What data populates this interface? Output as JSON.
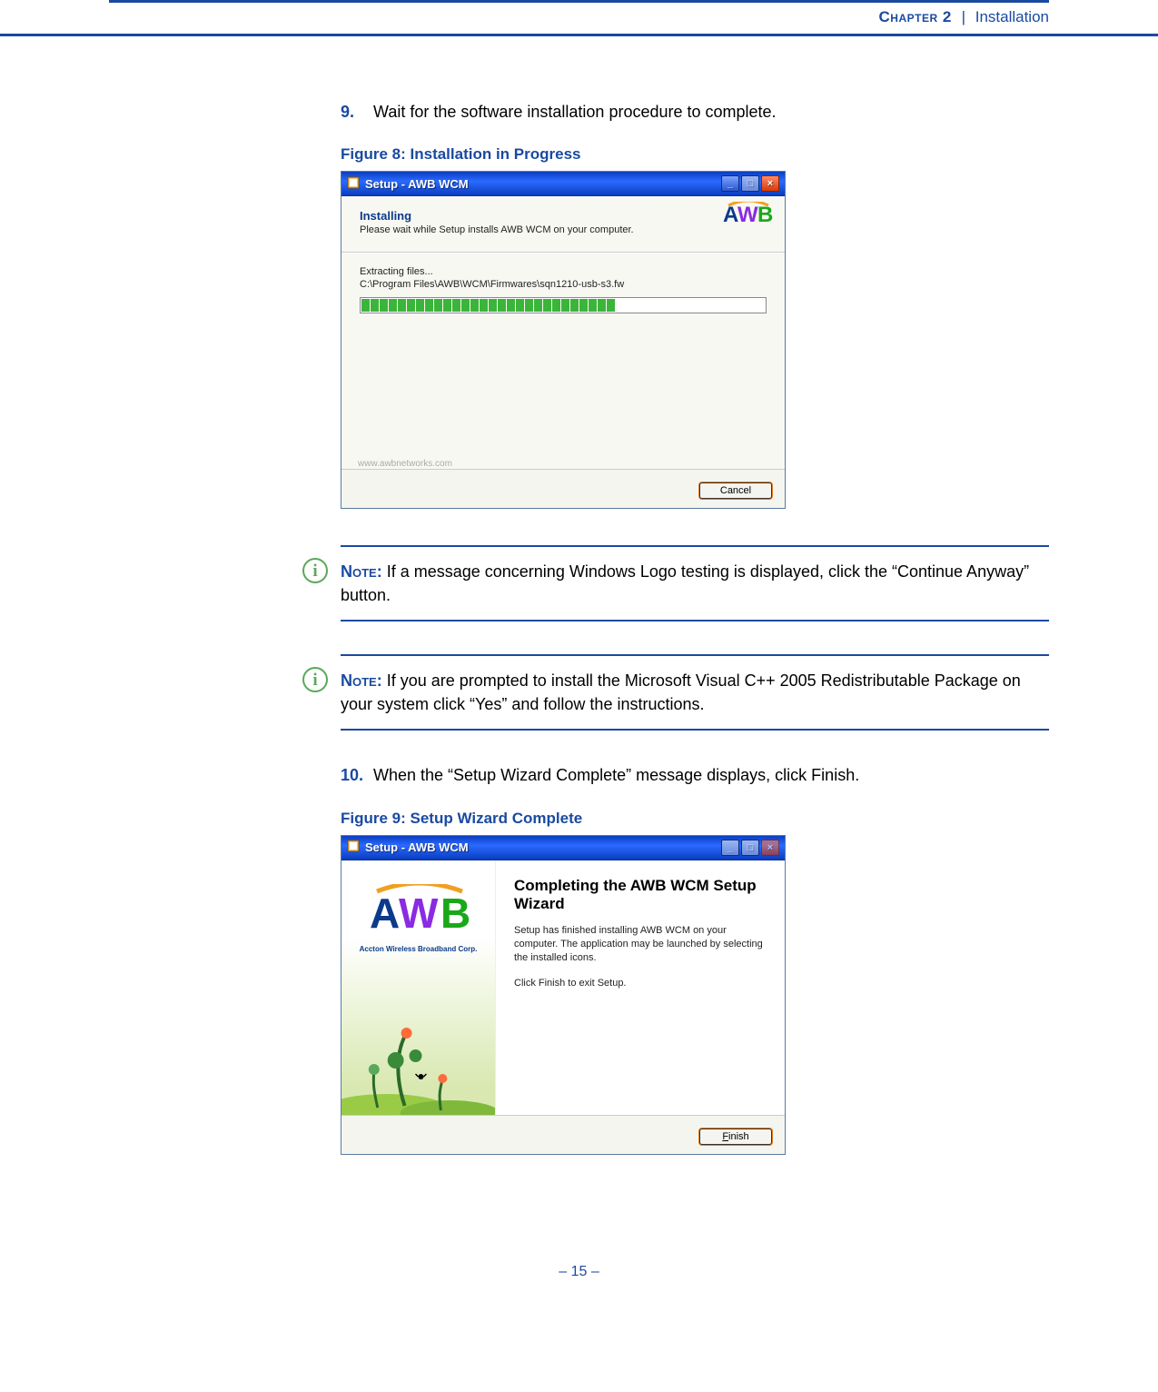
{
  "header": {
    "chapter": "Chapter 2",
    "separator": "|",
    "section": "Installation"
  },
  "step9": {
    "num": "9.",
    "text": "Wait for the software installation procedure to complete."
  },
  "figure8": {
    "caption": "Figure 8:  Installation in Progress",
    "titlebar": "Setup - AWB WCM",
    "installing_head": "Installing",
    "installing_sub": "Please wait while Setup installs AWB WCM on your computer.",
    "extracting": "Extracting files...",
    "path": "C:\\Program Files\\AWB\\WCM\\Firmwares\\sqn1210-usb-s3.fw",
    "website": "www.awbnetworks.com",
    "cancel": "Cancel",
    "progress_blocks": 28
  },
  "note1": {
    "prefix": "Note:",
    "text": " If a message concerning Windows Logo testing is displayed, click the “Continue Anyway” button."
  },
  "note2": {
    "prefix": "Note:",
    "text": " If you are prompted to install the Microsoft Visual C++ 2005 Redistributable Package on your system click “Yes” and follow the instructions."
  },
  "step10": {
    "num": "10.",
    "text": "When the “Setup Wizard Complete” message displays, click Finish."
  },
  "figure9": {
    "caption": "Figure 9:  Setup Wizard Complete",
    "titlebar": "Setup - AWB WCM",
    "heading": "Completing the AWB WCM Setup Wizard",
    "para1": "Setup has finished installing AWB WCM on your computer. The application may be launched by selecting the installed icons.",
    "para2": "Click Finish to exit Setup.",
    "corp": "Accton Wireless Broadband Corp.",
    "finish_u": "F",
    "finish_rest": "inish"
  },
  "footer": {
    "page": "–  15  –"
  }
}
